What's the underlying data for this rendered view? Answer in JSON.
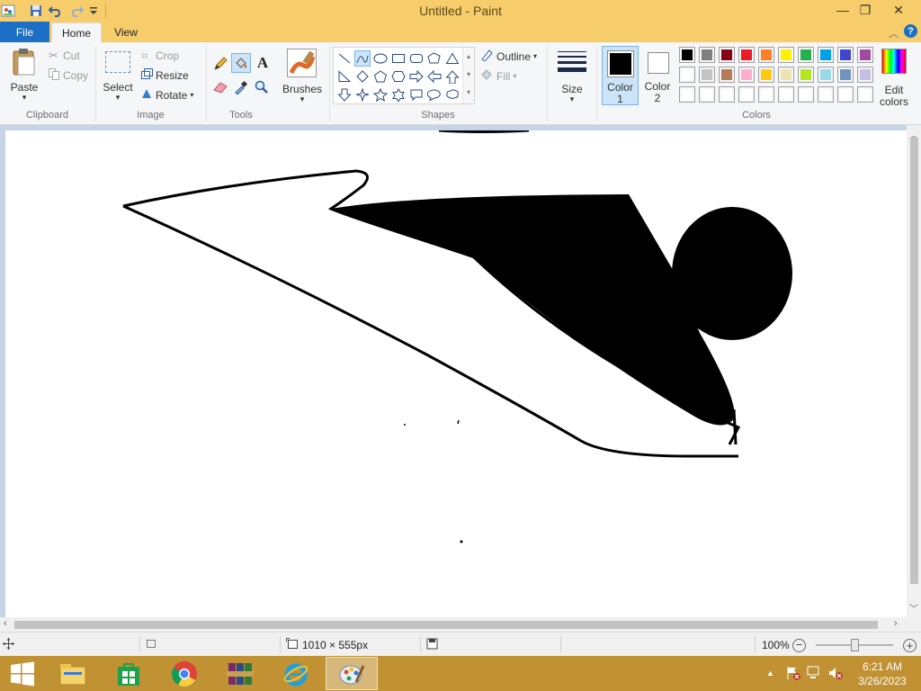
{
  "window": {
    "title": "Untitled - Paint",
    "minimize_glyph": "—",
    "restore_glyph": "❐",
    "close_glyph": "✕"
  },
  "quick_access": {
    "icons": [
      "paint-app-icon",
      "save-icon",
      "undo-icon",
      "redo-icon",
      "customize-qat-icon"
    ]
  },
  "tabs": {
    "file": "File",
    "home": "Home",
    "view": "View",
    "help_glyph": "?"
  },
  "ribbon": {
    "clipboard": {
      "group": "Clipboard",
      "paste": "Paste",
      "cut": "Cut",
      "copy": "Copy"
    },
    "image": {
      "group": "Image",
      "select": "Select",
      "crop": "Crop",
      "resize": "Resize",
      "rotate": "Rotate"
    },
    "tools": {
      "group": "Tools",
      "text_glyph": "A"
    },
    "brushes": {
      "label": "Brushes"
    },
    "shapes": {
      "group": "Shapes",
      "outline": "Outline",
      "fill": "Fill"
    },
    "size": {
      "label": "Size"
    },
    "color1": {
      "label_top": "Color",
      "label_bottom": "1",
      "value": "#000000"
    },
    "color2": {
      "label_top": "Color",
      "label_bottom": "2",
      "value": "#ffffff"
    },
    "colors": {
      "group": "Colors",
      "row1": [
        "#000000",
        "#7f7f7f",
        "#880015",
        "#ed1c24",
        "#ff7f27",
        "#fff200",
        "#22b14c",
        "#00a2e8",
        "#3f48cc",
        "#a349a4"
      ],
      "row2": [
        "#ffffff",
        "#c3c3c3",
        "#b97a57",
        "#ffaec9",
        "#ffc90e",
        "#efe4b0",
        "#b5e61d",
        "#99d9ea",
        "#7092be",
        "#c8bfe7"
      ],
      "row3": [
        "#ffffff",
        "#ffffff",
        "#ffffff",
        "#ffffff",
        "#ffffff",
        "#ffffff",
        "#ffffff",
        "#ffffff",
        "#ffffff",
        "#ffffff"
      ]
    },
    "edit_colors": {
      "line1": "Edit",
      "line2": "colors"
    }
  },
  "status": {
    "image_size": "1010 × 555px",
    "zoom": "100%",
    "zoom_fraction": 0.5
  },
  "taskbar": {
    "apps": [
      "start-icon",
      "file-explorer-icon",
      "store-icon",
      "chrome-icon",
      "winrar-icon",
      "internet-explorer-icon",
      "paint-taskbar-icon"
    ],
    "time": "6:21 AM",
    "date": "3/26/2023"
  }
}
